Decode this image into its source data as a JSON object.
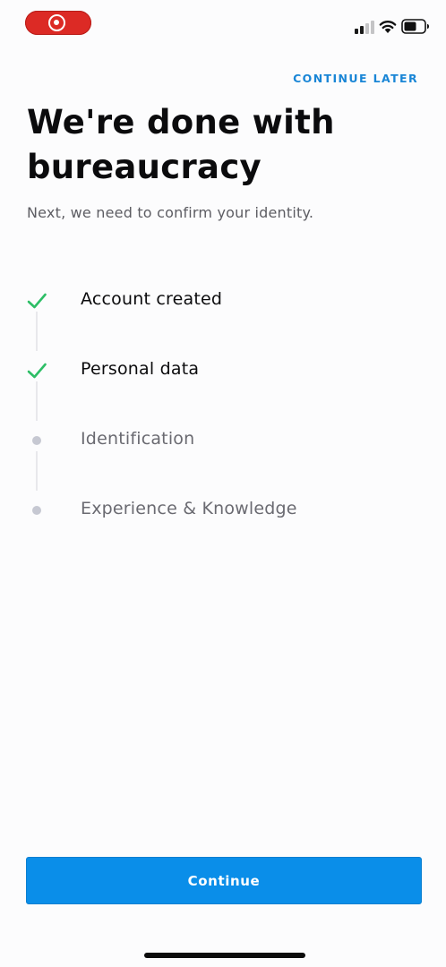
{
  "status_bar": {
    "recording_indicator_color": "#dc2a25",
    "signal_icon": "cellular-signal-icon",
    "wifi_icon": "wifi-icon",
    "battery_icon": "battery-icon",
    "battery_level": 0.55
  },
  "header": {
    "continue_later_label": "CONTINUE LATER"
  },
  "title": "We're done with bureaucracy",
  "subtitle": "Next, we need to confirm your identity.",
  "steps": [
    {
      "label": "Account created",
      "status": "done"
    },
    {
      "label": "Personal data",
      "status": "done"
    },
    {
      "label": "Identification",
      "status": "pending"
    },
    {
      "label": "Experience & Knowledge",
      "status": "pending"
    }
  ],
  "colors": {
    "accent": "#0a8ee9",
    "link": "#1a86d6",
    "check": "#2dbe66",
    "pending_dot": "#c6c8d2"
  },
  "footer": {
    "continue_label": "Continue"
  }
}
